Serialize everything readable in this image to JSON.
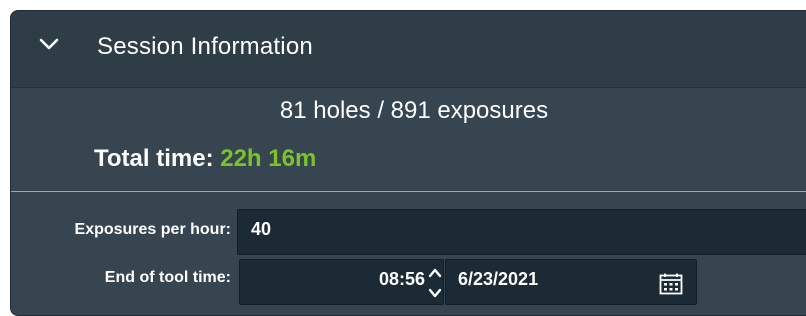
{
  "panel": {
    "title": "Session Information",
    "summary_text": "81 holes / 891 exposures",
    "total_time_label": "Total time:",
    "total_time_value": "22h 16m"
  },
  "form": {
    "exposures_per_hour_label": "Exposures per hour:",
    "exposures_per_hour_value": "40",
    "end_of_tool_time_label": "End of tool time:",
    "end_time_value": "08:56",
    "end_date_value": "6/23/2021"
  },
  "icons": {
    "collapse": "chevron-down-icon",
    "spinner": "spinner-arrows-icon",
    "calendar": "calendar-icon"
  },
  "colors": {
    "panel_bg": "#364550",
    "header_bg": "#2f3d47",
    "field_bg": "#1c2a35",
    "accent_green": "#7ec22b"
  }
}
